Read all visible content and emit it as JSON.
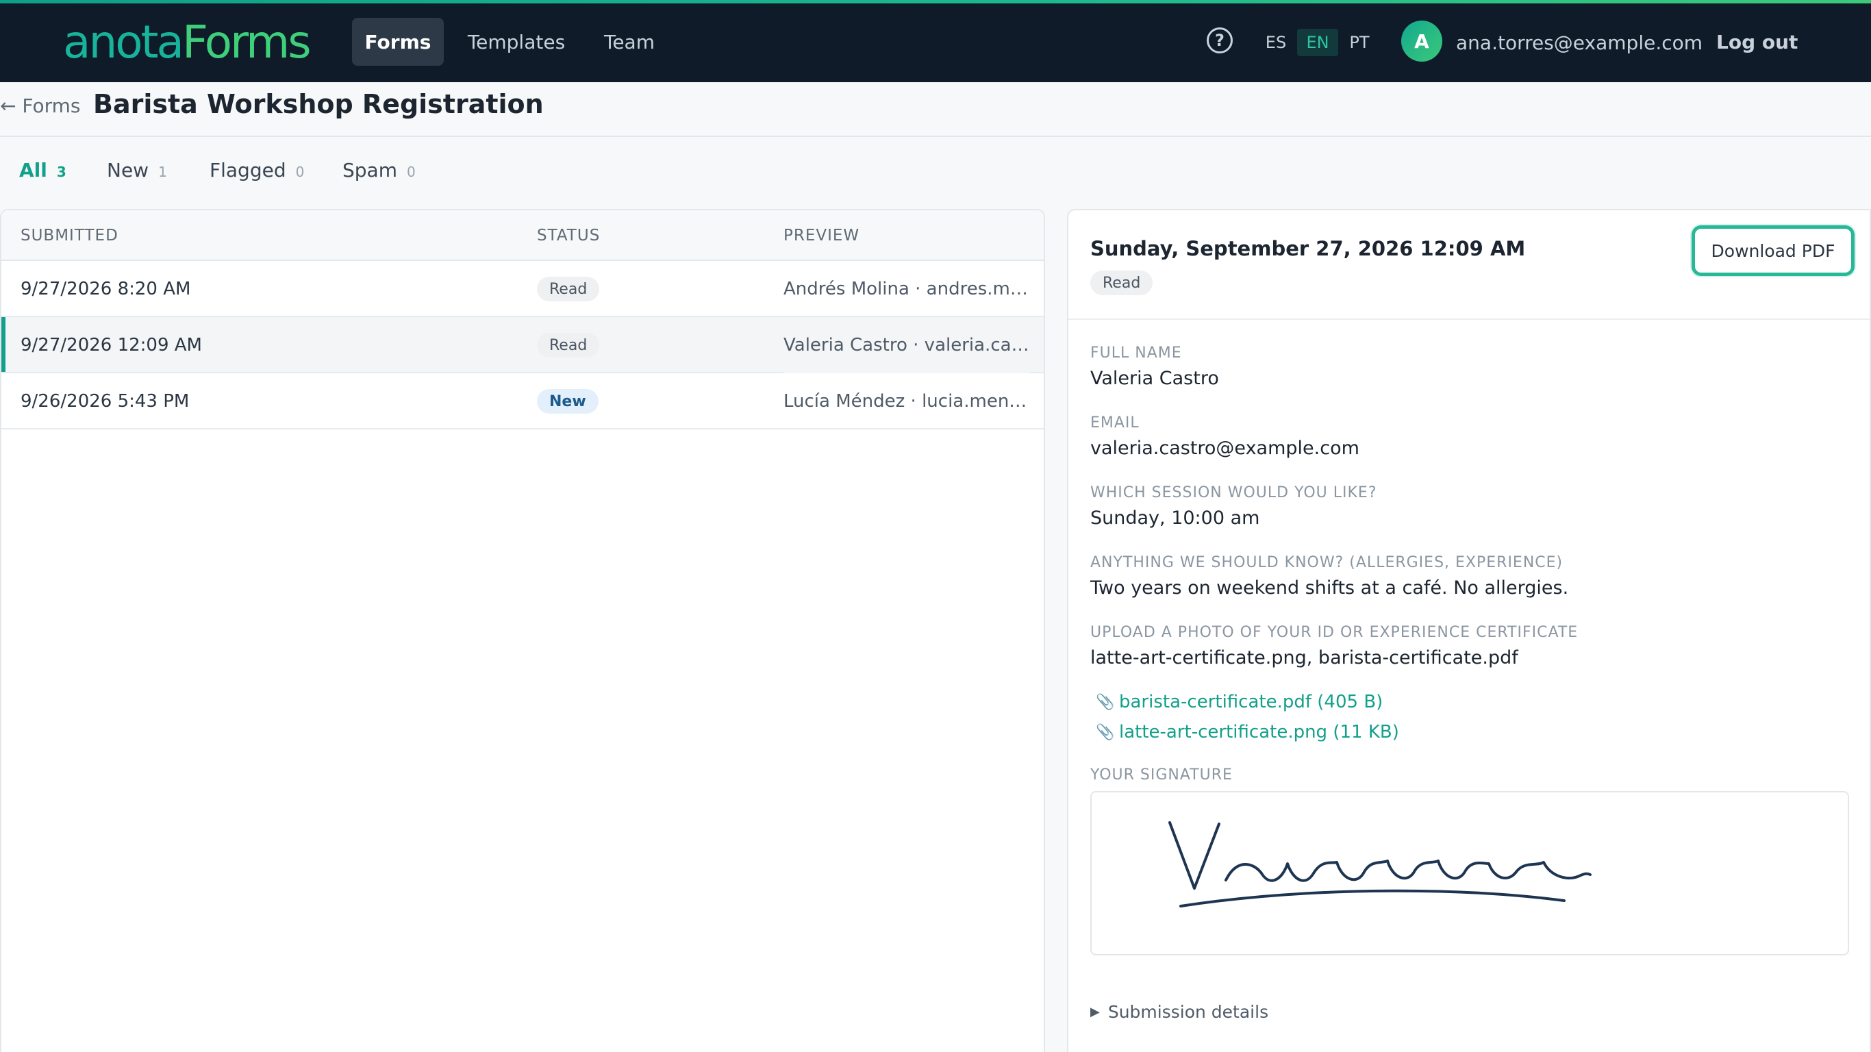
{
  "app": {
    "logo_part1": "anota",
    "logo_part2": "Forms",
    "nav": [
      {
        "label": "Forms",
        "active": true
      },
      {
        "label": "Templates",
        "active": false
      },
      {
        "label": "Team",
        "active": false
      }
    ],
    "help_icon": "question-circle-icon",
    "languages": [
      {
        "code": "ES",
        "active": false
      },
      {
        "code": "EN",
        "active": true
      },
      {
        "code": "PT",
        "active": false
      }
    ],
    "user": {
      "avatar_initial": "A",
      "email": "ana.torres@example.com"
    },
    "logout_label": "Log out",
    "colors": {
      "brand": "#12a08a",
      "nav_bg": "#0f1b29",
      "accent_green": "#3fcf7a"
    }
  },
  "header": {
    "back_label": "← Forms",
    "title": "Barista Workshop Registration"
  },
  "filters": [
    {
      "label": "All",
      "count": "3",
      "active": true
    },
    {
      "label": "New",
      "count": "1",
      "active": false
    },
    {
      "label": "Flagged",
      "count": "0",
      "active": false
    },
    {
      "label": "Spam",
      "count": "0",
      "active": false
    }
  ],
  "table": {
    "columns": [
      "SUBMITTED",
      "STATUS",
      "PREVIEW"
    ],
    "rows": [
      {
        "submitted": "9/27/2026 8:20 AM",
        "status": "Read",
        "preview": "Andrés Molina · andres.moli...",
        "selected": false
      },
      {
        "submitted": "9/27/2026 12:09 AM",
        "status": "Read",
        "preview": "Valeria Castro · valeria.castr...",
        "selected": true
      },
      {
        "submitted": "9/26/2026 5:43 PM",
        "status": "New",
        "preview": "Lucía Méndez · lucia.mende...",
        "selected": false
      }
    ]
  },
  "detail": {
    "date": "Sunday, September 27, 2026 12:09 AM",
    "status": "Read",
    "download_label": "Download PDF",
    "fields": [
      {
        "label": "FULL NAME",
        "value": "Valeria Castro"
      },
      {
        "label": "EMAIL",
        "value": "valeria.castro@example.com"
      },
      {
        "label": "WHICH SESSION WOULD YOU LIKE?",
        "value": "Sunday, 10:00 am"
      },
      {
        "label": "ANYTHING WE SHOULD KNOW? (ALLERGIES, EXPERIENCE)",
        "value": "Two years on weekend shifts at a café. No allergies."
      },
      {
        "label": "UPLOAD A PHOTO OF YOUR ID OR EXPERIENCE CERTIFICATE",
        "value": "latte-art-certificate.png, barista-certificate.pdf"
      }
    ],
    "attachments": [
      {
        "label": "barista-certificate.pdf (405 B)",
        "icon": "paperclip-icon"
      },
      {
        "label": "latte-art-certificate.png (11 KB)",
        "icon": "paperclip-icon"
      }
    ],
    "signature_label": "YOUR SIGNATURE",
    "details_toggle": "Submission details"
  }
}
